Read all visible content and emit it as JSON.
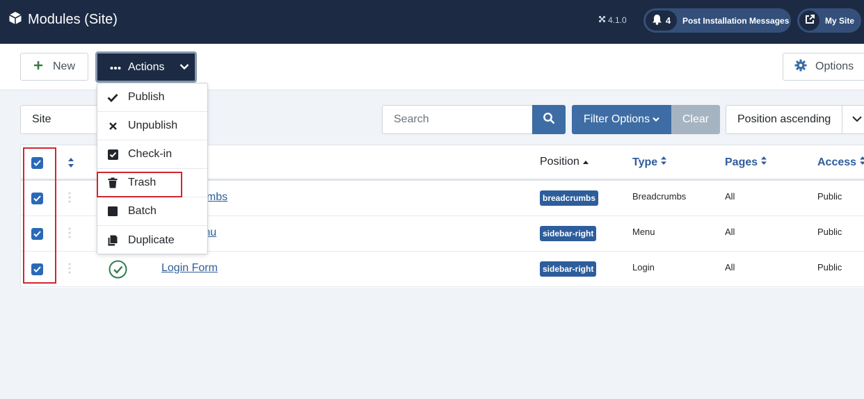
{
  "header": {
    "title": "Modules (Site)",
    "version": "4.1.0",
    "notifications": {
      "count": "4",
      "label": "Post Installation Messages"
    },
    "my_site": "My Site"
  },
  "toolbar": {
    "new_label": "New",
    "actions_label": "Actions",
    "options_label": "Options"
  },
  "actions_menu": {
    "items": [
      {
        "label": "Publish",
        "icon": "check-icon"
      },
      {
        "label": "Unpublish",
        "icon": "times-icon"
      },
      {
        "label": "Check-in",
        "icon": "check-square-icon"
      },
      {
        "label": "Trash",
        "icon": "trash-icon"
      },
      {
        "label": "Batch",
        "icon": "square-icon"
      },
      {
        "label": "Duplicate",
        "icon": "copy-icon"
      }
    ]
  },
  "filters": {
    "client": "Site",
    "search_placeholder": "Search",
    "filter_options": "Filter Options",
    "clear": "Clear",
    "sort": "Position ascending"
  },
  "table": {
    "headers": {
      "position": "Position",
      "type": "Type",
      "pages": "Pages",
      "access": "Access"
    },
    "rows": [
      {
        "title": "Breadcrumbs",
        "position": "breadcrumbs",
        "type": "Breadcrumbs",
        "pages": "All",
        "access": "Public",
        "checked": true
      },
      {
        "title": "Main Menu",
        "position": "sidebar-right",
        "type": "Menu",
        "pages": "All",
        "access": "Public",
        "checked": true
      },
      {
        "title": "Login Form",
        "position": "sidebar-right",
        "type": "Login",
        "pages": "All",
        "access": "Public",
        "checked": true,
        "published": true
      }
    ]
  },
  "colors": {
    "header_bg": "#1c2a43",
    "primary": "#3d6da4",
    "link": "#2d5d9b",
    "highlight": "#d0262f",
    "published": "#2f7d4b"
  }
}
